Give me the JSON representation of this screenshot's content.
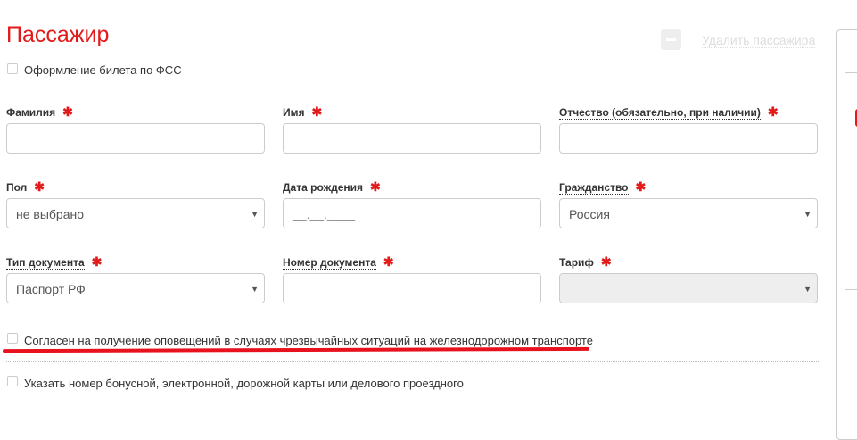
{
  "title": "Пассажир",
  "delete_label": "Удалить пассажира",
  "fss_label": "Оформление билета по ФСС",
  "fields": {
    "lastname": {
      "label": "Фамилия",
      "value": ""
    },
    "firstname": {
      "label": "Имя",
      "value": ""
    },
    "patronymic": {
      "label": "Отчество (обязательно, при наличии)",
      "value": ""
    },
    "gender": {
      "label": "Пол",
      "value": "не выбрано"
    },
    "birthdate": {
      "label": "Дата рождения",
      "value": "__.__.____"
    },
    "citizenship": {
      "label": "Гражданство",
      "value": "Россия"
    },
    "doctype": {
      "label": "Тип документа",
      "value": "Паспорт РФ"
    },
    "docnumber": {
      "label": "Номер документа",
      "value": ""
    },
    "tariff": {
      "label": "Тариф",
      "value": ""
    }
  },
  "required_mark": "✱",
  "consent_label": "Согласен на получение оповещений в случаях чрезвычайных ситуаций на железнодорожном транспорте",
  "card_label": "Указать номер бонусной, электронной, дорожной карты или делового проездного"
}
